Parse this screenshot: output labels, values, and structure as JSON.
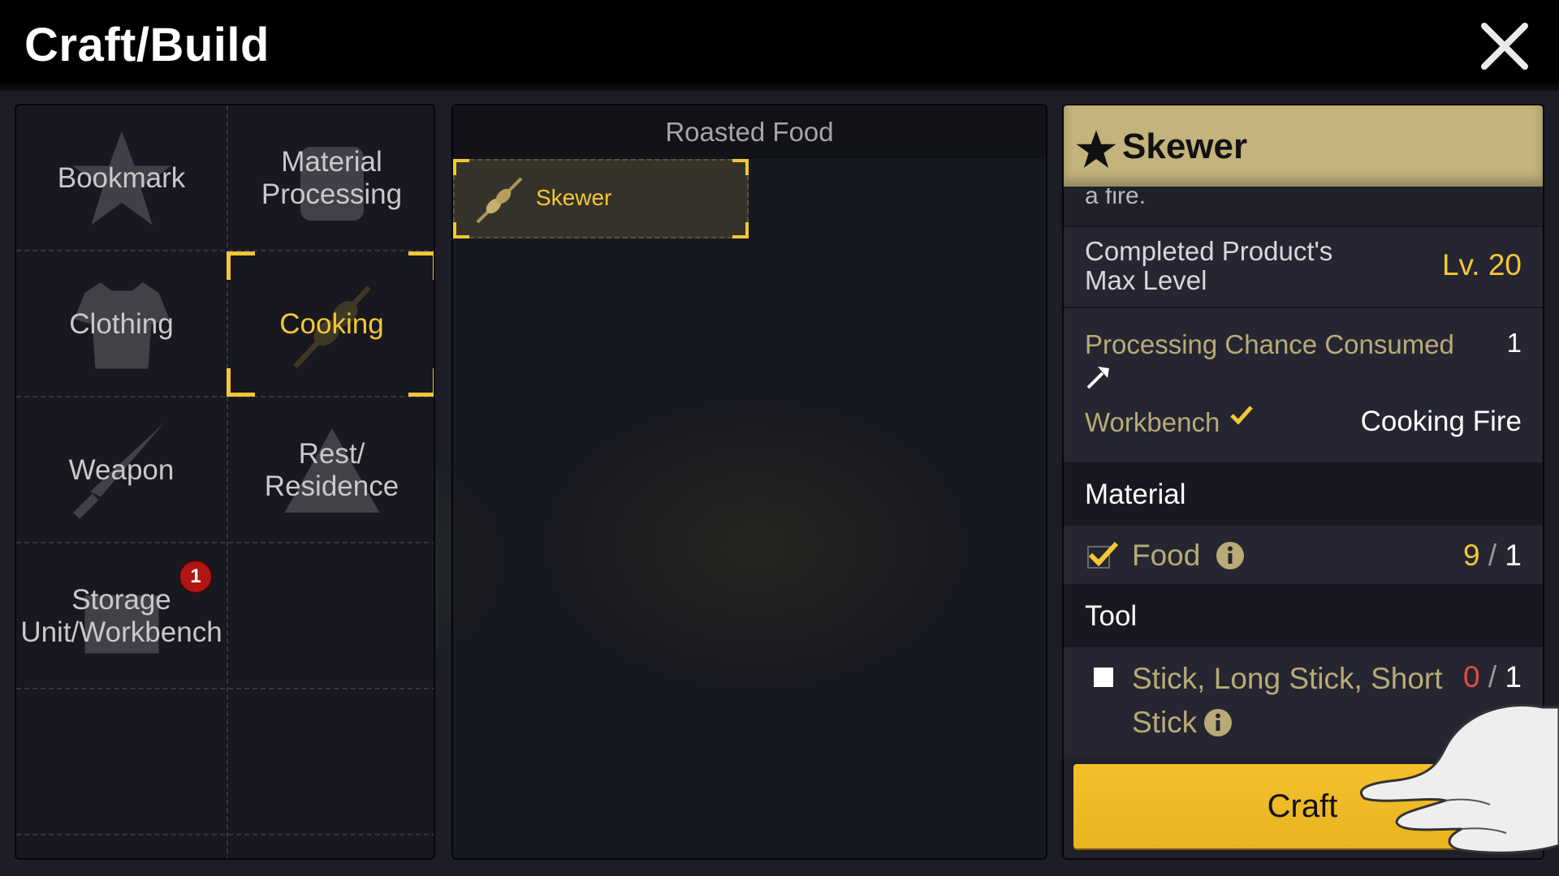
{
  "header": {
    "title": "Craft/Build"
  },
  "categories": [
    {
      "label": "Bookmark"
    },
    {
      "label": "Material\nProcessing"
    },
    {
      "label": "Clothing"
    },
    {
      "label": "Cooking",
      "selected": true
    },
    {
      "label": "Weapon"
    },
    {
      "label": "Rest/\nResidence"
    },
    {
      "label": "Storage\nUnit/Workbench",
      "badge": "1"
    }
  ],
  "recipe_list": {
    "header": "Roasted Food",
    "items": [
      {
        "label": "Skewer",
        "selected": true
      }
    ]
  },
  "detail": {
    "name": "Skewer",
    "cut_text": "a fire.",
    "max_level_label": "Completed Product's\nMax Level",
    "max_level_value": "Lv. 20",
    "chance_label": "Processing Chance Consumed",
    "chance_value": "1",
    "workbench_label": "Workbench",
    "workbench_value": "Cooking Fire",
    "material_header": "Material",
    "materials": [
      {
        "name": "Food",
        "have": "9",
        "sep": "/",
        "need": "1",
        "satisfied": true
      }
    ],
    "tool_header": "Tool",
    "tools": [
      {
        "name": "Stick, Long Stick, Short\nStick",
        "have": "0",
        "sep": "/",
        "need": "1",
        "satisfied": false
      }
    ],
    "craft_label": "Craft"
  },
  "colors": {
    "accent": "#f3c736",
    "insufficient": "#e24c3c",
    "craft_button": "#f0bc2a"
  }
}
